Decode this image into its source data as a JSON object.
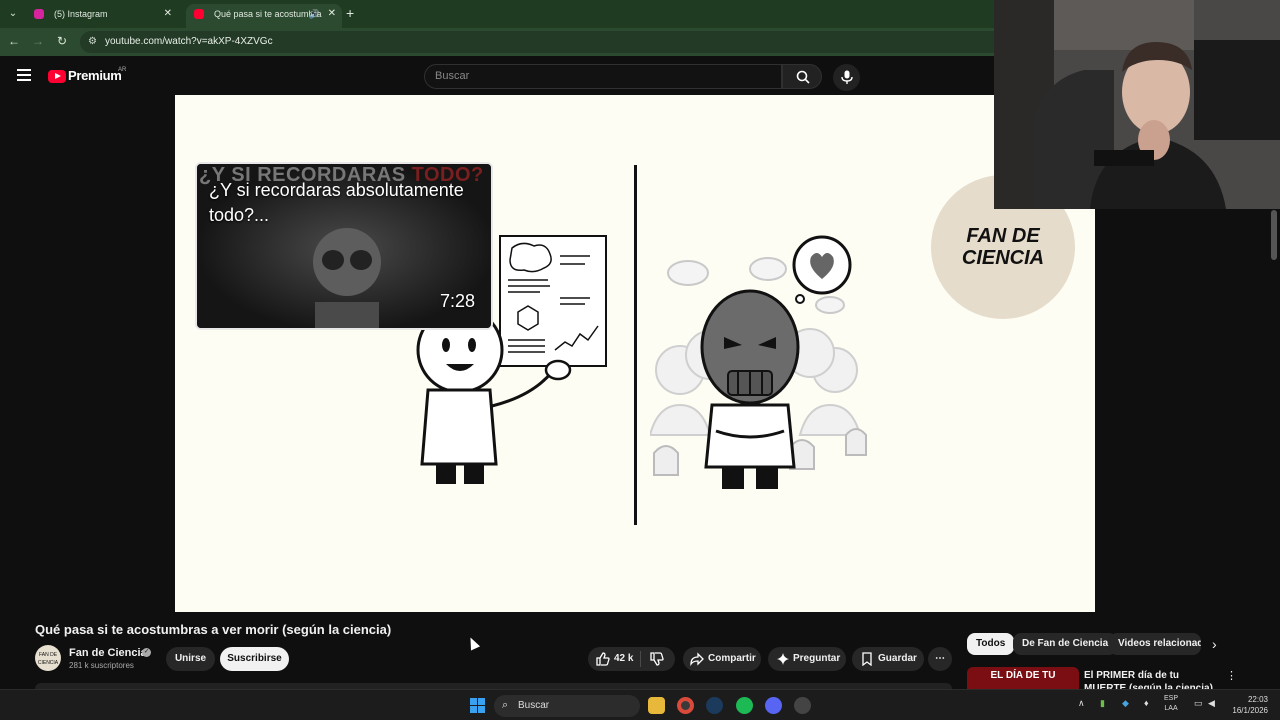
{
  "browser": {
    "tabs": [
      {
        "label": "(5) Instagram",
        "favicon_color": "#d6249f"
      },
      {
        "label": "Qué pasa si te acostumbra",
        "favicon_color": "#ff0033"
      }
    ],
    "new_tab_glyph": "+",
    "address": "youtube.com/watch?v=akXP-4XZVGc"
  },
  "youtube": {
    "brand": "Premium",
    "region": "AR",
    "search_placeholder": "Buscar"
  },
  "video": {
    "end_card": {
      "banner": "¿Y SI RECORDARAS",
      "banner_accent": "TODO?",
      "title": "¿Y si recordaras absolutamente todo?...",
      "duration": "7:28"
    },
    "watermark": "FAN DE CIENCIA"
  },
  "below": {
    "title": "Qué pasa si te acostumbras a ver morir (según la ciencia)",
    "channel": {
      "avatar_text": "FAN DE CIENCIA",
      "name": "Fan de Ciencia",
      "subscribers": "281 k suscriptores",
      "join": "Unirse",
      "subscribe": "Suscribirse"
    },
    "actions": {
      "likes": "42 k",
      "share": "Compartir",
      "ask": "Preguntar",
      "save": "Guardar",
      "more": "⋯"
    }
  },
  "sidebar": {
    "chips": [
      "Todos",
      "De Fan de Ciencia",
      "Videos relacionados"
    ],
    "recommended": {
      "thumb_text": "EL DÍA DE TU",
      "title": "El PRIMER día de tu MUERTE (según la ciencia)"
    }
  },
  "taskbar": {
    "search": "Buscar",
    "language": [
      "ESP",
      "LAA"
    ],
    "time": "22:03",
    "date": "16/1/2026"
  }
}
